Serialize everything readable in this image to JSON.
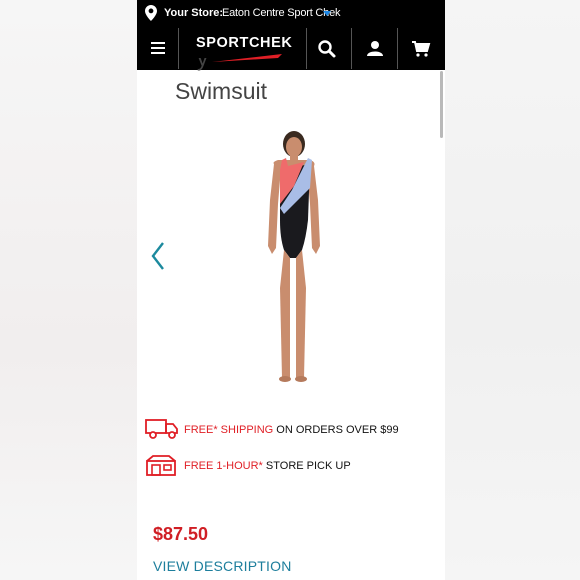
{
  "store": {
    "label": "Your Store:",
    "name": "Eaton Centre Sport Chek"
  },
  "header": {
    "logo_text": "SPORTCHEK",
    "icons": [
      "menu-icon",
      "search-icon",
      "account-icon",
      "cart-icon"
    ]
  },
  "product": {
    "title": "Swimsuit",
    "title_above_cut": "y",
    "image_alt": "Women's one-piece swimsuit in black with coral and light blue diagonal panels",
    "colors": {
      "black": "#1a1a1e",
      "coral": "#ef6b6b",
      "light_blue": "#a9bde6",
      "skin": "#c98d6e"
    },
    "price": "$87.50",
    "view_description": "VIEW DESCRIPTION"
  },
  "promos": [
    {
      "icon": "truck-icon",
      "highlight": "FREE* SHIPPING",
      "rest": " ON ORDERS OVER $99"
    },
    {
      "icon": "store-pickup-icon",
      "highlight": "FREE 1-HOUR*",
      "rest": " STORE PICK UP"
    }
  ],
  "theme": {
    "header_bg": "#000000",
    "accent_red": "#e01f26",
    "price_red": "#d01e24",
    "link_teal": "#1d7e9c",
    "chevron_teal": "#1c8a9e",
    "store_caret_blue": "#1e88e5"
  }
}
